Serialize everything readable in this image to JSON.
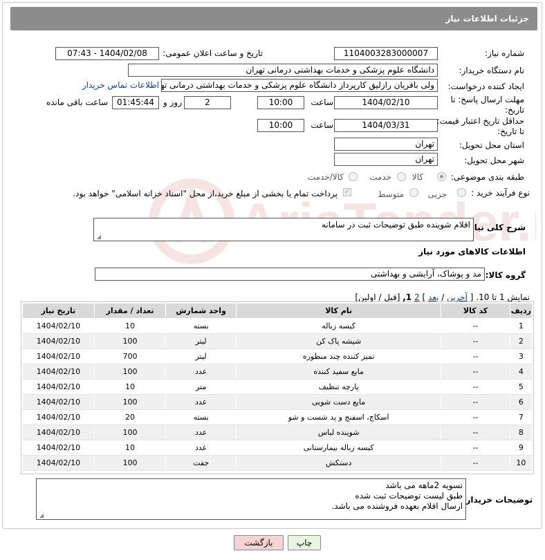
{
  "header": {
    "title": "جزئیات اطلاعات نیاز"
  },
  "form": {
    "need_number_label": "شماره نیاز:",
    "need_number": "1104003283000007",
    "announce_label": "تاریخ و ساعت اعلان عمومی:",
    "announce_value": "1404/02/08 - 07:43",
    "buyer_org_label": "نام دستگاه خریدار:",
    "buyer_org": "دانشگاه علوم پزشکی و خدمات بهداشتی درمانی تهران",
    "creator_label": "ایجاد کننده درخواست:",
    "creator": "ولی باقریان رازلیق کارپرداز دانشگاه علوم پزشکی و خدمات بهداشتی درمانی تهران",
    "contact_link": "اطلاعات تماس خریدار",
    "deadline_label_1": "مهلت ارسال پاسخ: تا",
    "deadline_label_2": "تاریخ:",
    "deadline_date": "1404/02/10",
    "time_label": "ساعت",
    "deadline_time": "10:00",
    "days_value": "2",
    "days_label": "روز و",
    "remaining_time": "01:45:44",
    "remaining_label": "ساعت باقی مانده",
    "min_validity_label_1": "حداقل تاریخ اعتبار قیمت:",
    "min_validity_label_2": "تا تاریخ:",
    "validity_date": "1404/03/31",
    "validity_time": "10:00",
    "province_label": "استان محل تحویل:",
    "province": "تهران",
    "city_label": "شهر محل تحویل:",
    "city": "تهران",
    "category_label": "طبقه بندی موضوعی:",
    "category_options": [
      "کالا",
      "خدمت",
      "کالا/خدمت"
    ],
    "category_selected": "کالا",
    "process_label": "نوع فرآیند خرید :",
    "process_options": [
      "جزیی",
      "متوسط"
    ],
    "payment_note": "پرداخت تمام یا بخشی از مبلغ خرید،از محل \"اسناد خزانه اسلامی\" خواهد بود.",
    "description_label": "شرح کلی نیاز:",
    "description": "اقلام شوینده طبق توضیحات ثبت در سامانه",
    "goods_section_title": "اطلاعات کالاهای مورد نیاز",
    "goods_group_label": "گروه کالا:",
    "goods_group": "مد و پوشاک، آرایشی و بهداشتی"
  },
  "pager": {
    "show_text": "نمایش 1 تا 10. [",
    "last": "آخرین",
    "sep1": " / ",
    "next": "بعد",
    "close_bracket": "]",
    "page2": "2",
    "page1": "1,",
    "prev_first": "[قبل / اولین]"
  },
  "table": {
    "headers": [
      "ردیف",
      "کد کالا",
      "نام کالا",
      "واحد شمارش",
      "تعداد / مقدار",
      "تاریخ نیاز"
    ],
    "rows": [
      [
        "1",
        "--",
        "کیسه زباله",
        "بسته",
        "10",
        "1404/02/10"
      ],
      [
        "2",
        "--",
        "شیشه پاک کن",
        "لیتر",
        "100",
        "1404/02/10"
      ],
      [
        "3",
        "--",
        "تمیز کننده چند منظوره",
        "لیتر",
        "700",
        "1404/02/10"
      ],
      [
        "4",
        "--",
        "مایع سفید کننده",
        "عدد",
        "100",
        "1404/02/10"
      ],
      [
        "5",
        "--",
        "پارچه تنظیف",
        "متر",
        "10",
        "1404/02/10"
      ],
      [
        "6",
        "--",
        "مایع دست شویی",
        "عدد",
        "100",
        "1404/02/10"
      ],
      [
        "7",
        "--",
        "اسکاچ، اسفنج و پد شست و شو",
        "بسته",
        "20",
        "1404/02/10"
      ],
      [
        "8",
        "--",
        "شوینده لباس",
        "عدد",
        "100",
        "1404/02/10"
      ],
      [
        "9",
        "--",
        "کیسه زباله بیمارستانی",
        "عدد",
        "10",
        "1404/02/10"
      ],
      [
        "10",
        "--",
        "دستکش",
        "جفت",
        "100",
        "1404/02/10"
      ]
    ]
  },
  "buyer_notes": {
    "label": "توضیحات خریدار:",
    "line1": "تسویه 2ماهه می باشد",
    "line2": "طبق لیست توضیحات ثبت شده",
    "line3": "ارسال اقلام بعهده فروشنده می باشد."
  },
  "buttons": {
    "print": "چاپ",
    "back": "بازگشت"
  },
  "colors": {
    "header_bg": "#8c8c8c",
    "back_button_bg": "#f7d4d4",
    "print_button_bg": "#e6f5e0",
    "link": "#0b3fa8"
  },
  "watermark_text": "AriaTender.net"
}
